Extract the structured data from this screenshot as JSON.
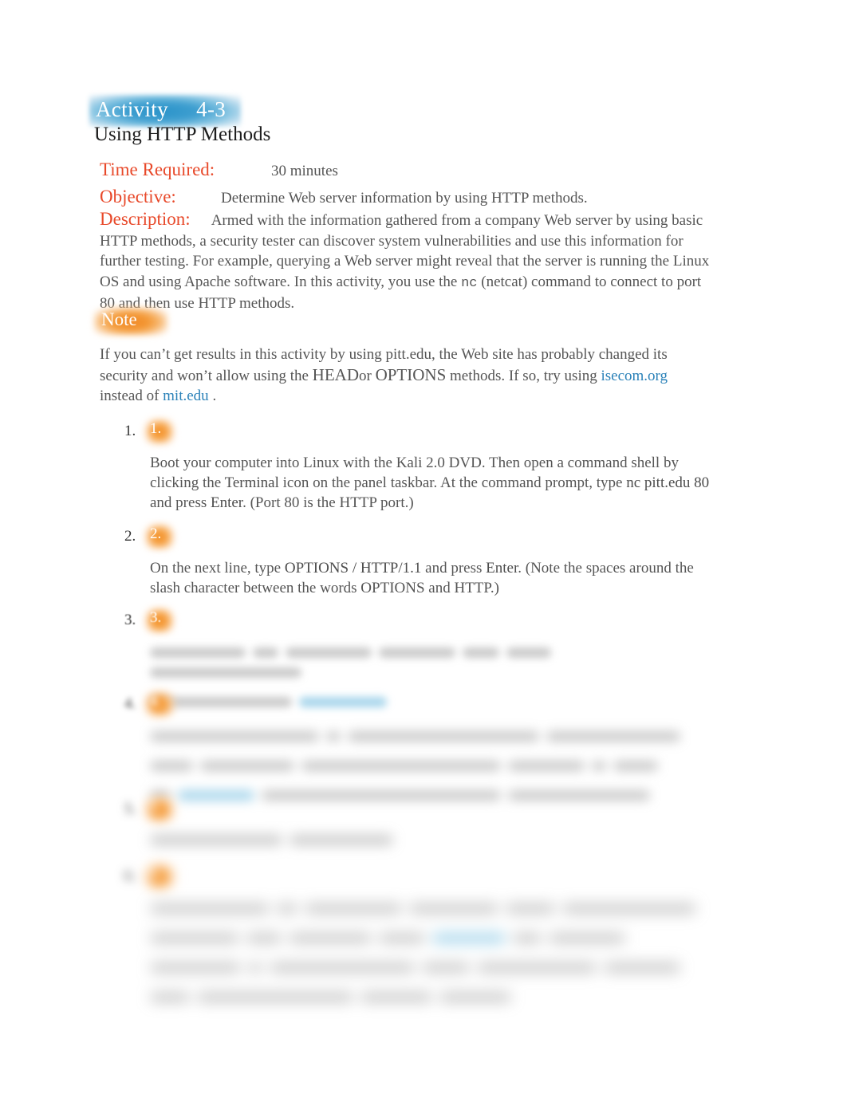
{
  "activity": {
    "badge_label": "Activity     4-3",
    "title": "Using HTTP Methods"
  },
  "meta": {
    "time_label": "Time Required:",
    "time_value": "30 minutes",
    "objective_label": "Objective:",
    "objective_value": "Determine Web server information by using HTTP methods.",
    "description_label": "Description:"
  },
  "description": {
    "part1": "Armed with the information gathered from a company Web server by using basic HTTP methods, a security tester can discover system vulnerabilities and use this information for further testing. For example, querying a Web server might reveal that the server is running the Linux OS and using Apache software. In this activity, you use the ",
    "mono_cmd": "nc",
    "part2": " (netcat) command to connect to port 80 and then use HTTP methods."
  },
  "note": {
    "badge_label": "Note",
    "text_1": "If you can’t get results in this activity by using pitt.edu, the Web site has probably changed its security and won’t allow using the ",
    "head_kw": "HEAD",
    "text_2": "or ",
    "options_kw": "OPTIONS",
    "text_3": " methods. If so, try using ",
    "link_1": "isecom.org",
    "text_4": " instead of ",
    "link_2": "mit.edu",
    "text_5": " ."
  },
  "steps": [
    {
      "marker": "1.",
      "badge": "1.",
      "visible": true,
      "text_a": "Boot your computer into Linux with the Kali 2.0 DVD. Then open a command shell by clicking the ",
      "bold_a": "Terminal",
      "text_b": " icon on the panel taskbar. At the command prompt, type ",
      "bold_b": "nc pitt.edu 80",
      "text_c": " and press ",
      "bold_c": "Enter",
      "text_d": ". (Port 80 is the HTTP port.)"
    },
    {
      "marker": "2.",
      "badge": "2.",
      "visible": true,
      "text_a": "On the next line, type ",
      "bold_a": "OPTIONS / HTTP/1.1",
      "text_b": " and press ",
      "bold_b": "Enter",
      "text_c": ". (Note the spaces around the slash character between the words OPTIONS and HTTP.)"
    },
    {
      "marker": "3.",
      "badge": "3.",
      "visible": false,
      "blur": "light"
    },
    {
      "marker": "4.",
      "badge": "4.",
      "visible": false,
      "blur": "medium"
    },
    {
      "marker": "5.",
      "badge": "5.",
      "visible": false,
      "blur": "heavy"
    },
    {
      "marker": "6.",
      "badge": "6.",
      "visible": false,
      "blur": "heaviest"
    }
  ],
  "colors": {
    "accent_orange": "#e8492a",
    "badge_blue": "#2a93c9",
    "badge_orange": "#f29130",
    "link_blue": "#2a81b8",
    "body_text": "#555555"
  }
}
